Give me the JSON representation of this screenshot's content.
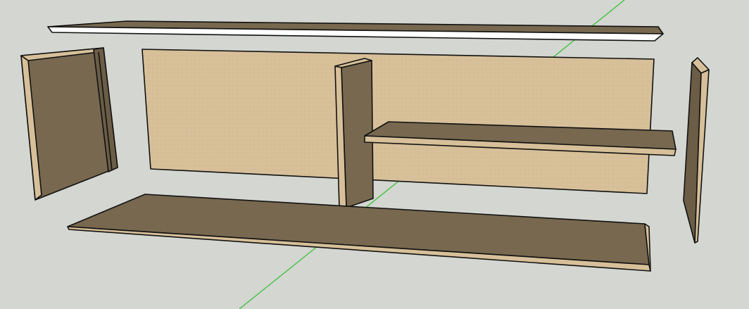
{
  "scene": {
    "axis_color": "#2fbf2f",
    "background": "#d4d6d1",
    "colors": {
      "mdf_face": "#d7c099",
      "mdf_edge": "#cdb48a",
      "dark_face": "#77684f",
      "dark_face_shade": "#6b5d46",
      "white_board": "#ffffff",
      "outline": "#111111"
    },
    "parts": [
      "top-board",
      "left-side-panel",
      "back-panel",
      "divider-panel",
      "shelf",
      "bottom-board",
      "right-side-panel"
    ]
  }
}
